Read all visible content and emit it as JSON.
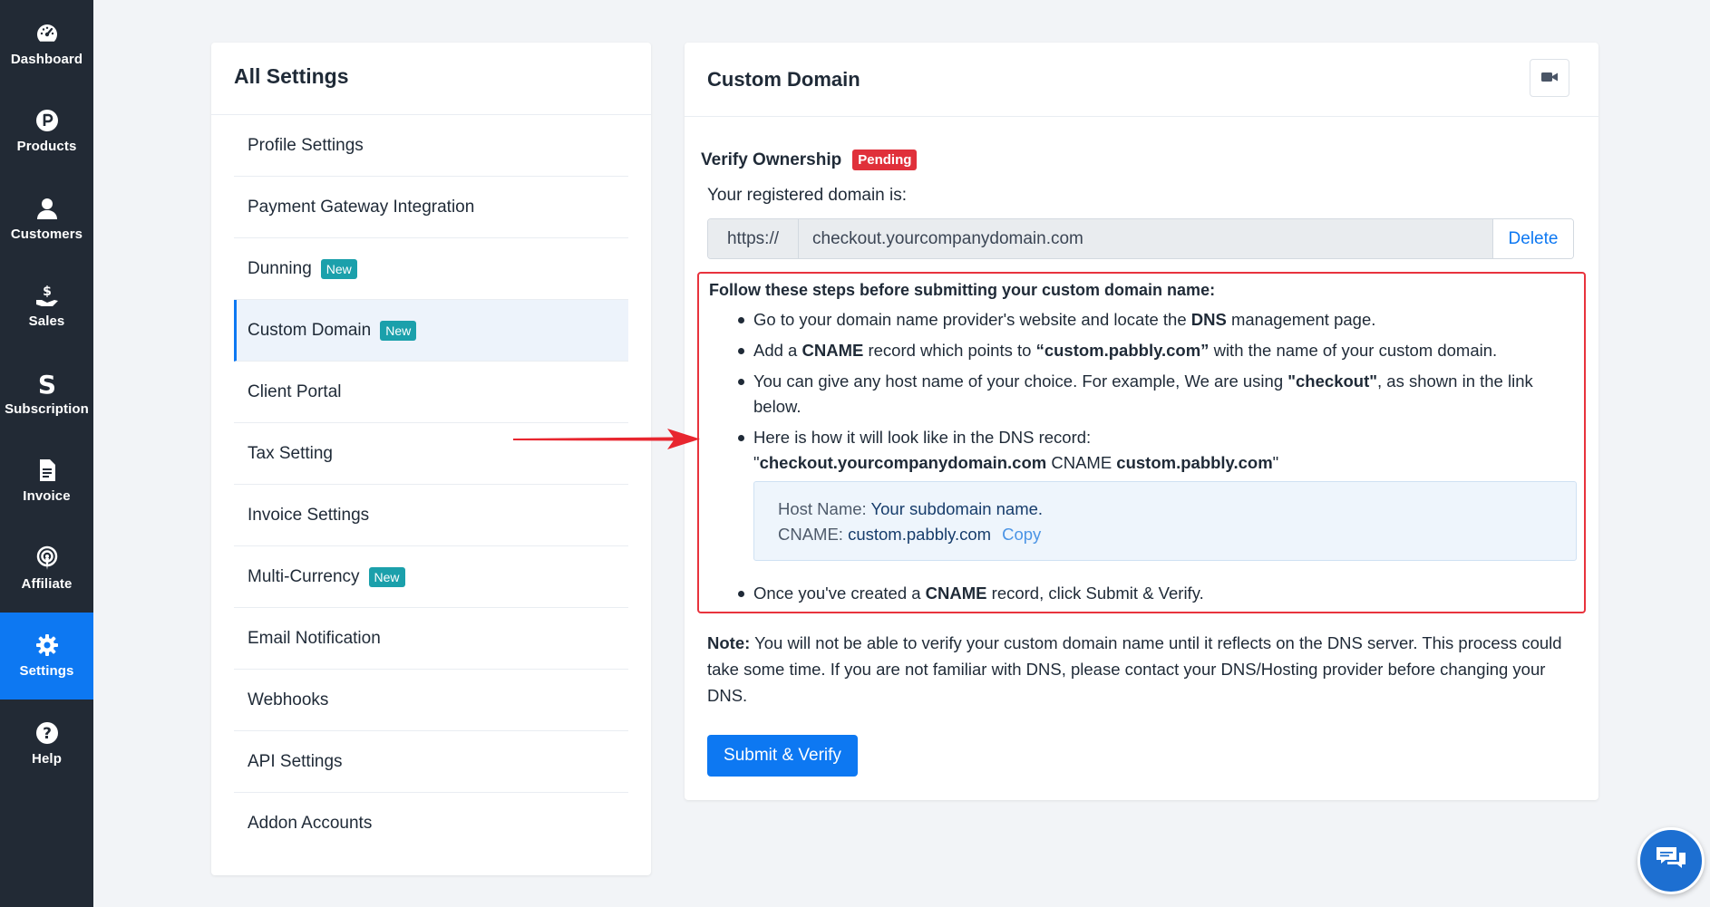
{
  "sidebar": {
    "items": [
      {
        "label": "Dashboard",
        "icon": "dashboard-icon",
        "active": false
      },
      {
        "label": "Products",
        "icon": "products-icon",
        "active": false
      },
      {
        "label": "Customers",
        "icon": "customers-icon",
        "active": false
      },
      {
        "label": "Sales",
        "icon": "sales-icon",
        "active": false
      },
      {
        "label": "Subscription",
        "icon": "subscription-icon",
        "active": false
      },
      {
        "label": "Invoice",
        "icon": "invoice-icon",
        "active": false
      },
      {
        "label": "Affiliate",
        "icon": "affiliate-icon",
        "active": false
      },
      {
        "label": "Settings",
        "icon": "gear-icon",
        "active": true
      },
      {
        "label": "Help",
        "icon": "help-icon",
        "active": false
      }
    ]
  },
  "settings_panel": {
    "title": "All Settings",
    "items": [
      {
        "label": "Profile Settings",
        "badge": ""
      },
      {
        "label": "Payment Gateway Integration",
        "badge": ""
      },
      {
        "label": "Dunning",
        "badge": "New"
      },
      {
        "label": "Custom Domain",
        "badge": "New"
      },
      {
        "label": "Client Portal",
        "badge": ""
      },
      {
        "label": "Tax Setting",
        "badge": ""
      },
      {
        "label": "Invoice Settings",
        "badge": ""
      },
      {
        "label": "Multi-Currency",
        "badge": "New"
      },
      {
        "label": "Email Notification",
        "badge": ""
      },
      {
        "label": "Webhooks",
        "badge": ""
      },
      {
        "label": "API Settings",
        "badge": ""
      },
      {
        "label": "Addon Accounts",
        "badge": ""
      }
    ]
  },
  "main": {
    "title": "Custom Domain",
    "verify_title": "Verify Ownership",
    "status_badge": "Pending",
    "registered_label": "Your registered domain is:",
    "domain_prefix": "https://",
    "domain_value": "checkout.yourcompanydomain.com",
    "delete_label": "Delete",
    "steps": {
      "title": "Follow these steps before submitting your custom domain name:",
      "step1_pre": "Go to your domain name provider's website and locate the ",
      "step1_bold": "DNS",
      "step1_post": " management page.",
      "step2_pre": "Add a ",
      "step2_bold1": "CNAME",
      "step2_mid": " record which points to ",
      "step2_bold2": "“custom.pabbly.com”",
      "step2_post": " with the name of your custom domain.",
      "step3_pre": "You can give any host name of your choice. For example, We are using ",
      "step3_bold": "\"checkout\"",
      "step3_post": ", as shown in the link below.",
      "step4_line1": "Here is how it will look like in the DNS record:",
      "step4_q1": "\"",
      "step4_bold1": "checkout.yourcompanydomain.com",
      "step4_mid": " CNAME ",
      "step4_bold2": "custom.pabbly.com",
      "step4_q2": "\"",
      "host_label": "Host Name: ",
      "host_value": "Your subdomain name.",
      "cname_label": "CNAME: ",
      "cname_value": "custom.pabbly.com",
      "copy_label": "Copy",
      "step5_pre": "Once you've created a ",
      "step5_bold": "CNAME",
      "step5_post": " record, click Submit & Verify."
    },
    "note_label": "Note:",
    "note_text": " You will not be able to verify your custom domain name until it reflects on the DNS server. This process could take some time. If you are not familiar with DNS, please contact your DNS/Hosting provider before changing your DNS.",
    "submit_label": "Submit & Verify"
  },
  "colors": {
    "sidebar_bg": "#222a35",
    "accent": "#0d78f2",
    "badge_new": "#1ba0ab",
    "badge_pending": "#e0303a",
    "highlight_border": "#e8333d",
    "chat_widget": "#1d6fd1"
  }
}
